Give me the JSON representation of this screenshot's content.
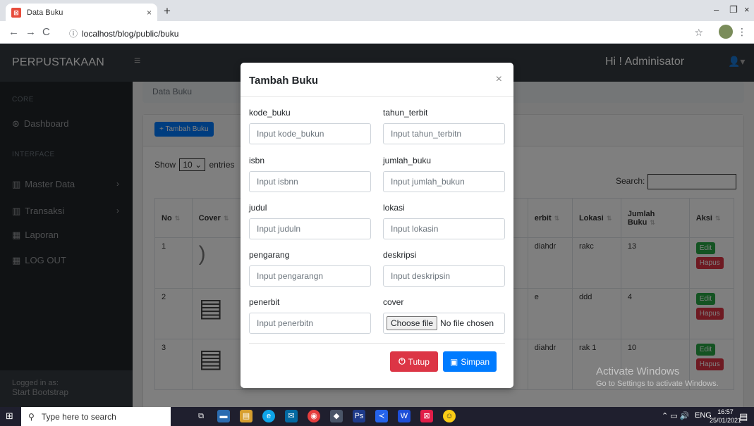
{
  "browser": {
    "tab_title": "Data Buku",
    "tab_close": "×",
    "new_tab": "+",
    "url": "localhost/blog/public/buku",
    "win_min": "–",
    "win_max": "❐",
    "win_close": "×"
  },
  "topnav": {
    "brand": "PERPUSTAKAAN",
    "menu_icon": "≡",
    "greeting": "Hi ! Adminisator",
    "user_icon": "👤▾"
  },
  "sidebar": {
    "heading_core": "CORE",
    "heading_interface": "INTERFACE",
    "items": [
      {
        "icon": "⊛",
        "label": "Dashboard"
      },
      {
        "icon": "▥",
        "label": "Master Data"
      },
      {
        "icon": "▥",
        "label": "Transaksi"
      },
      {
        "icon": "▦",
        "label": "Laporan"
      },
      {
        "icon": "▦",
        "label": "LOG OUT"
      }
    ],
    "chevron": "›",
    "footer_small": "Logged in as:",
    "footer_big": "Start Bootstrap"
  },
  "main": {
    "breadcrumb": "Data Buku",
    "add_button": "+ Tambah Buku",
    "show": "Show",
    "entries_value": "10",
    "entries": "entries",
    "search_label": "Search:",
    "sort_icon": "⇅",
    "columns": [
      "No",
      "Cover",
      "erbit",
      "Lokasi",
      "Jumlah Buku",
      "Aksi"
    ],
    "rows": [
      {
        "no": "1",
        "penerbit": "diahdr",
        "lokasi": "rakc",
        "jumlah": "13"
      },
      {
        "no": "2",
        "penerbit": "e",
        "lokasi": "ddd",
        "jumlah": "4"
      },
      {
        "no": "3",
        "penerbit": "diahdr",
        "lokasi": "rak 1",
        "jumlah": "10"
      }
    ],
    "edit_label": "Edit",
    "hapus_label": "Hapus"
  },
  "modal": {
    "title": "Tambah Buku",
    "close": "×",
    "fields": [
      {
        "label": "kode_buku",
        "placeholder": "Input kode_bukun"
      },
      {
        "label": "tahun_terbit",
        "placeholder": "Input tahun_terbitn"
      },
      {
        "label": "isbn",
        "placeholder": "Input isbnn"
      },
      {
        "label": "jumlah_buku",
        "placeholder": "Input jumlah_bukun"
      },
      {
        "label": "judul",
        "placeholder": "Input juduln"
      },
      {
        "label": "lokasi",
        "placeholder": "Input lokasin"
      },
      {
        "label": "pengarang",
        "placeholder": "Input pengarangn"
      },
      {
        "label": "deskripsi",
        "placeholder": "Input deskripsin"
      },
      {
        "label": "penerbit",
        "placeholder": "Input penerbitn"
      },
      {
        "label": "cover",
        "file_button": "Choose file",
        "file_status": "No file chosen"
      }
    ],
    "btn_tutup": "Tutup",
    "btn_simpan": "Simpan"
  },
  "watermark": {
    "line1": "Activate Windows",
    "line2": "Go to Settings to activate Windows."
  },
  "taskbar": {
    "search_placeholder": "Type here to search",
    "lang": "ENG",
    "time": "16:57",
    "date": "25/01/2021"
  }
}
